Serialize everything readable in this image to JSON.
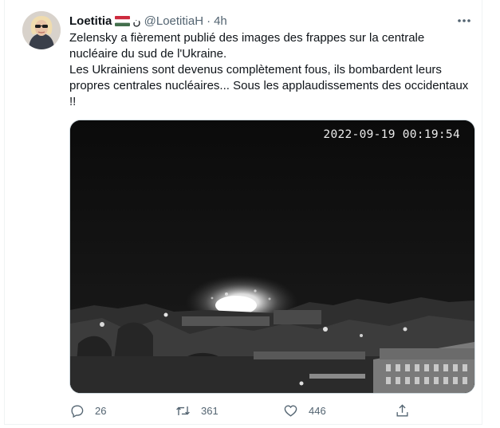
{
  "tweet": {
    "author_name": "Loetitia",
    "flag_mark": "ن",
    "handle": "@LoetitiaH",
    "separator": "·",
    "time": "4h",
    "more_label": "•••",
    "paragraph_1_line_1": "Zelensky a fièrement publié des images des frappes sur la centrale",
    "paragraph_1_line_2": "nucléaire du sud de l'Ukraine.",
    "paragraph_2_line_1": "Les Ukrainiens sont devenus complètement fous, ils bombardent leurs",
    "paragraph_2_line_2": "propres centrales nucléaires... Sous les applaudissements des occidentaux",
    "paragraph_2_line_3": "!!"
  },
  "media": {
    "timestamp_overlay": "2022-09-19 00:19:54"
  },
  "actions": {
    "reply_count": "26",
    "retweet_count": "361",
    "like_count": "446"
  },
  "colors": {
    "text_primary": "#0f1419",
    "text_secondary": "#536471",
    "flag_red": "#cd2a3e",
    "flag_white": "#ffffff",
    "flag_green": "#436f4d"
  },
  "icons": [
    "reply-icon",
    "retweet-icon",
    "like-icon",
    "share-icon",
    "more-icon"
  ]
}
